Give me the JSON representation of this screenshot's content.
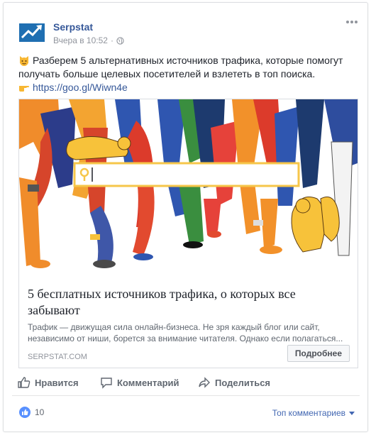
{
  "post": {
    "page_name": "Serpstat",
    "timestamp": "Вчера в 10:52",
    "text": "Разберем 5 альтернативных источников трафика, которые помогут получать больше целевых посетителей и взлететь в топ поиска.",
    "link": "https://goo.gl/Wiwn4e"
  },
  "card": {
    "title": "5 бесплатных источников трафика, о которых все забывают",
    "description": "Трафик — движущая сила онлайн-бизнеса. Не зря каждый блог или сайт, независимо от ниши, борется за внимание читателя. Однако если полагаться...",
    "domain": "SERPSTAT.COM",
    "button": "Подробнее"
  },
  "actions": {
    "like": "Нравится",
    "comment": "Комментарий",
    "share": "Поделиться"
  },
  "footer": {
    "like_count": "10",
    "sort_label": "Топ комментариев"
  },
  "colors": {
    "link_blue": "#365899",
    "accent_blue": "#4267b2",
    "search_yellow": "#f6c64a",
    "cat_yellow": "#f7c23a"
  }
}
